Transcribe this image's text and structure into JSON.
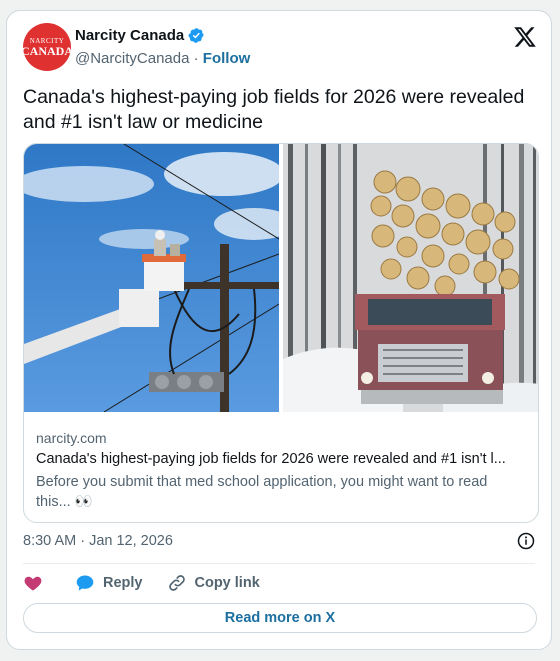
{
  "account": {
    "name": "Narcity Canada",
    "handle": "@NarcityCanada",
    "separator": " · ",
    "follow_label": "Follow",
    "avatar_text_top": "NARCITY",
    "avatar_text_bottom": "CANADA"
  },
  "tweet": {
    "text": "Canada's highest-paying job fields for 2026 were revealed and #1 isn't law or medicine",
    "timestamp": "8:30 AM · Jan 12, 2026"
  },
  "link_card": {
    "domain": "narcity.com",
    "title": "Canada's highest-paying job fields for 2026 were revealed and #1 isn't l...",
    "description": "Before you submit that med school application, you might want to read this... 👀",
    "left_image": "lineman-utility-bucket-truck",
    "right_image": "logging-truck-snow-forest"
  },
  "actions": {
    "reply_label": "Reply",
    "copy_link_label": "Copy link",
    "read_more_label": "Read more on X"
  },
  "icons": {
    "verified": "verified-badge-icon",
    "logo": "x-logo-icon",
    "like": "heart-icon",
    "reply": "reply-bubble-icon",
    "copy": "link-icon",
    "info": "info-icon"
  },
  "colors": {
    "accent": "#1d6fa0",
    "verified": "#1d9bf0",
    "heart": "#c43b74",
    "brand_red": "#e03131"
  }
}
